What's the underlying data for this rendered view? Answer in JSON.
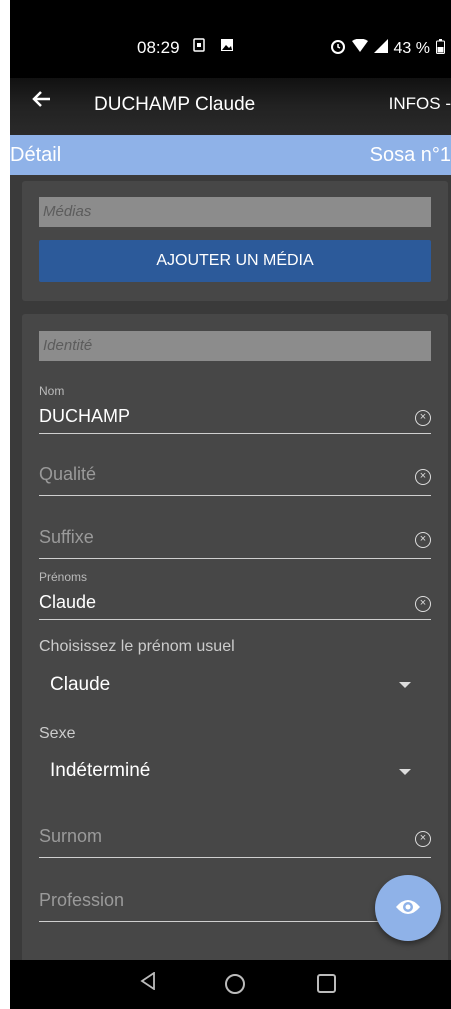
{
  "status": {
    "time": "08:29",
    "battery": "43 %"
  },
  "appbar": {
    "title": "DUCHAMP Claude",
    "infos": "INFOS -"
  },
  "bar": {
    "left": "Détail",
    "right": "Sosa n°1"
  },
  "medias": {
    "section": "Médias",
    "add_button": "AJOUTER UN MÉDIA"
  },
  "identite": {
    "section": "Identité",
    "nom_label": "Nom",
    "nom_value": "DUCHAMP",
    "qualite_placeholder": "Qualité",
    "suffixe_placeholder": "Suffixe",
    "prenoms_label": "Prénoms",
    "prenoms_value": "Claude",
    "prenom_usuel_label": "Choisissez le prénom usuel",
    "prenom_usuel_value": "Claude",
    "sexe_label": "Sexe",
    "sexe_value": "Indéterminé",
    "surnom_placeholder": "Surnom",
    "profession_placeholder": "Profession"
  },
  "icons": {
    "back": "arrow-left-icon",
    "clear": "clear-circle-icon",
    "fab": "eye-icon",
    "dropdown": "caret-down-icon"
  },
  "colors": {
    "accent": "#8fb2e8",
    "button": "#2c5a9a",
    "background": "#3a3a3a"
  }
}
